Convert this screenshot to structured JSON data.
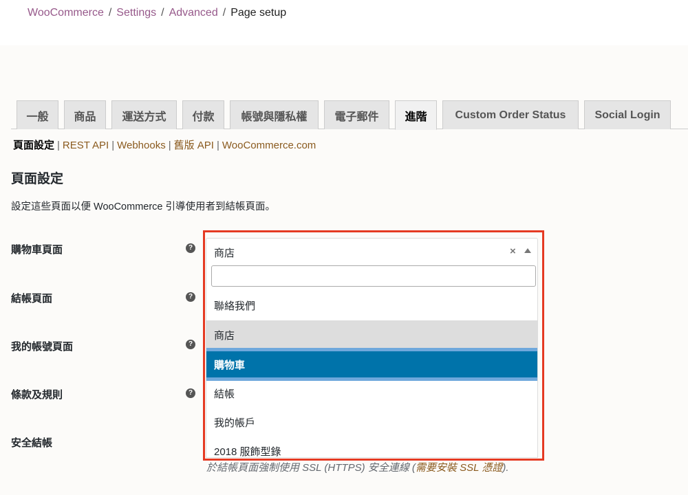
{
  "breadcrumb": {
    "items": [
      "WooCommerce",
      "Settings",
      "Advanced"
    ],
    "separator": "/",
    "current": "Page setup"
  },
  "tabs": [
    {
      "label": "一般",
      "active": false
    },
    {
      "label": "商品",
      "active": false
    },
    {
      "label": "運送方式",
      "active": false
    },
    {
      "label": "付款",
      "active": false
    },
    {
      "label": "帳號與隱私權",
      "active": false
    },
    {
      "label": "電子郵件",
      "active": false
    },
    {
      "label": "進階",
      "active": true
    },
    {
      "label": "Custom Order Status",
      "active": false
    },
    {
      "label": "Social Login",
      "active": false
    }
  ],
  "subnav": {
    "current": "頁面設定",
    "links": [
      "REST API",
      "Webhooks",
      "舊版 API",
      "WooCommerce.com"
    ],
    "separator": "|"
  },
  "section": {
    "title": "頁面設定",
    "description": "設定這些頁面以便 WooCommerce 引導使用者到結帳頁面。"
  },
  "fields": [
    {
      "label": "購物車頁面",
      "help_icon": "question-circle-icon"
    },
    {
      "label": "結帳頁面",
      "help_icon": "question-circle-icon"
    },
    {
      "label": "我的帳號頁面",
      "help_icon": "question-circle-icon"
    },
    {
      "label": "條款及規則",
      "help_icon": "question-circle-icon"
    },
    {
      "label": "安全結帳"
    }
  ],
  "select": {
    "value": "商店",
    "clear_symbol": "×",
    "search_value": "",
    "search_placeholder": "",
    "options": [
      {
        "label": "聯絡我們",
        "state": "normal"
      },
      {
        "label": "商店",
        "state": "hover"
      },
      {
        "label": "購物車",
        "state": "selected"
      },
      {
        "label": "結帳",
        "state": "normal"
      },
      {
        "label": "我的帳戶",
        "state": "normal"
      },
      {
        "label": "2018 服飾型錄",
        "state": "normal"
      }
    ]
  },
  "ssl": {
    "description_prefix": "於結帳頁面強制使用 SSL (HTTPS) 安全連線 (",
    "link": "需要安裝 SSL 憑證",
    "description_suffix": ")."
  },
  "colors": {
    "breadcrumb_link": "#96588a",
    "subnav_link": "#8a5a1e",
    "highlight_border": "#e53a23",
    "selected_option": "#0073aa",
    "hover_option": "#dddddd"
  }
}
